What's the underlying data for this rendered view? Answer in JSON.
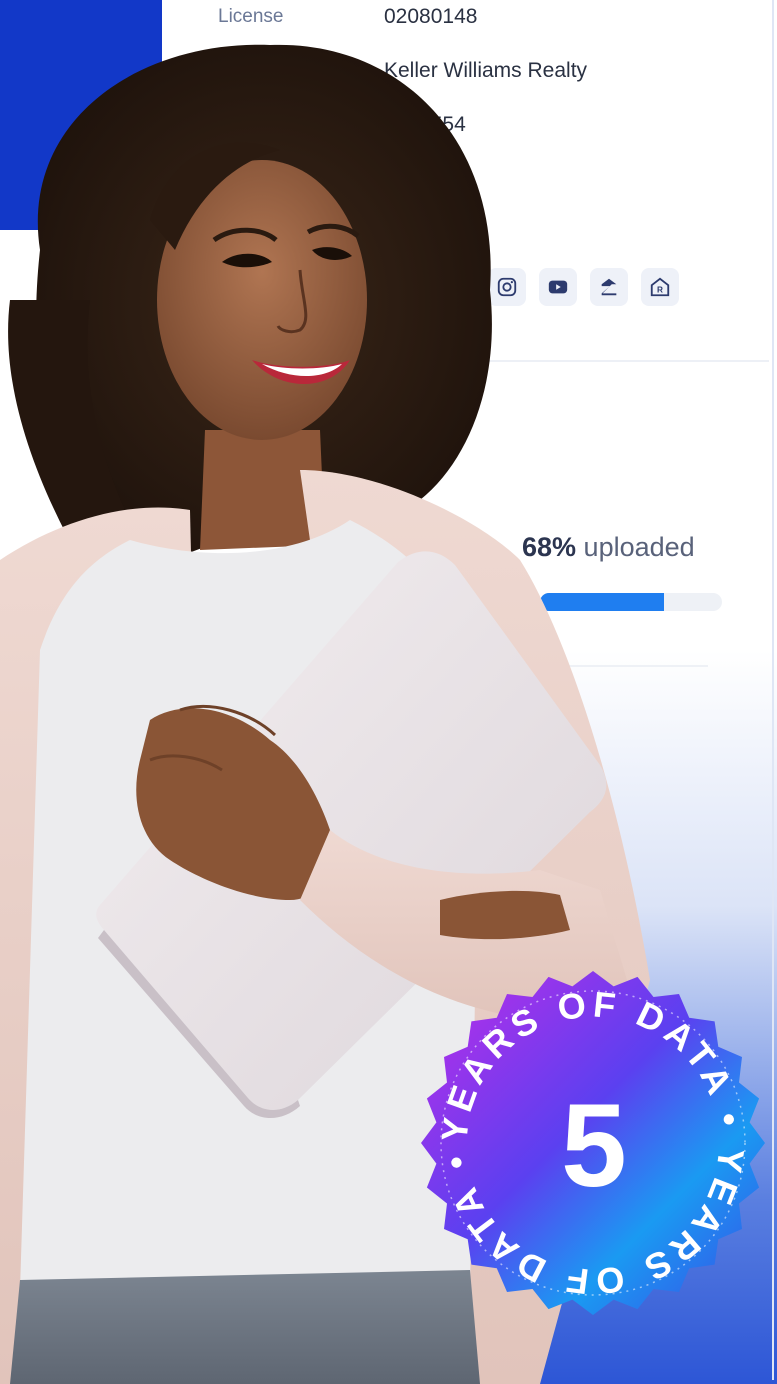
{
  "profile": {
    "license_label": "License",
    "license_number": "02080148",
    "brokerage": "Keller Williams Realty",
    "phone_partial": "4545554"
  },
  "social": [
    {
      "name": "instagram-icon"
    },
    {
      "name": "youtube-icon"
    },
    {
      "name": "zillow-icon"
    },
    {
      "name": "realtor-icon"
    }
  ],
  "upload": {
    "percent_text": "68%",
    "suffix": " uploaded",
    "progress": 0.68
  },
  "badge": {
    "number": "5",
    "ring_text": "YEARS OF DATA • YEARS OF DATA • "
  },
  "colors": {
    "brand_blue": "#1238c8",
    "progress_blue": "#1f7ef0"
  }
}
